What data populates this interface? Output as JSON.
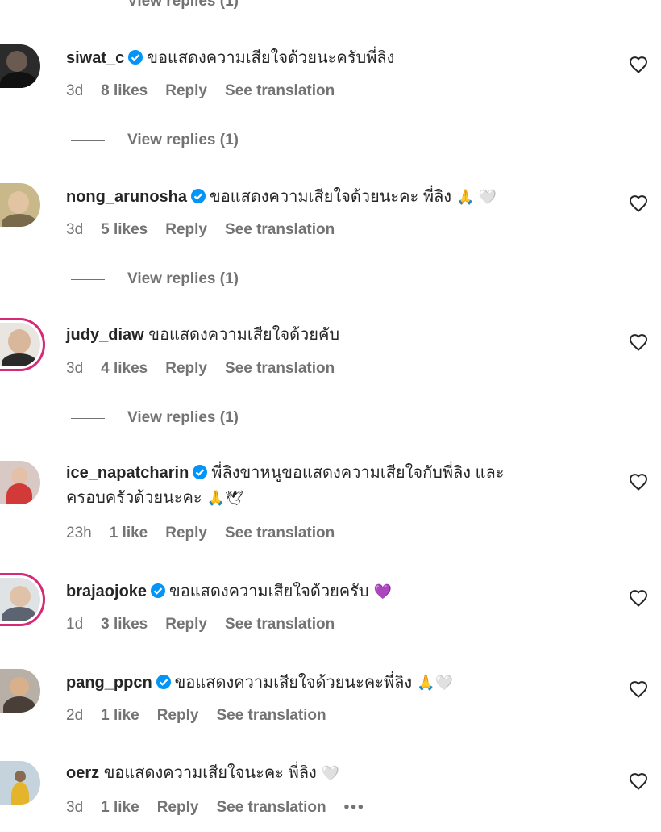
{
  "view_replies_label": "View replies (1)",
  "reply_label": "Reply",
  "see_translation_label": "See translation",
  "more_dots": "•••",
  "colors": {
    "verified": "#0095f6",
    "ring": "#d62976",
    "muted": "#737373",
    "text": "#262626"
  },
  "comments": [
    {
      "user": "siwat_c",
      "verified": true,
      "text": "ขอแสดงความเสียใจด้วยนะครับพี่ลิง",
      "text2": "",
      "emoji": "",
      "time": "3d",
      "likes": "8 likes",
      "avatar_ring": false
    },
    {
      "user": "nong_arunosha",
      "verified": true,
      "text": "ขอแสดงความเสียใจด้วยนะคะ พี่ลิง",
      "text2": "",
      "emoji": "🙏 🤍",
      "time": "3d",
      "likes": "5 likes",
      "avatar_ring": false
    },
    {
      "user": "judy_diaw",
      "verified": false,
      "text": "ขอแสดงความเสียใจด้วยคับ",
      "text2": "",
      "emoji": "",
      "time": "3d",
      "likes": "4 likes",
      "avatar_ring": true
    },
    {
      "user": "ice_napatcharin",
      "verified": true,
      "text": "พี่ลิงขาหนูขอแสดงความเสียใจกับพี่ลิง และ",
      "text2": "ครอบครัวด้วยนะคะ",
      "emoji": "🙏🕊",
      "time": "23h",
      "likes": "1 like",
      "avatar_ring": false
    },
    {
      "user": "brajaojoke",
      "verified": true,
      "text": "ขอแสดงความเสียใจด้วยครับ",
      "text2": "",
      "emoji": "💜",
      "time": "1d",
      "likes": "3 likes",
      "avatar_ring": true
    },
    {
      "user": "pang_ppcn",
      "verified": true,
      "text": "ขอแสดงความเสียใจด้วยนะคะพี่ลิง",
      "text2": "",
      "emoji": "🙏🤍",
      "time": "2d",
      "likes": "1 like",
      "avatar_ring": false
    },
    {
      "user": "oerz",
      "verified": false,
      "text": "ขอแสดงความเสียใจนะคะ พี่ลิง",
      "text2": "",
      "emoji": "🤍",
      "time": "3d",
      "likes": "1 like",
      "avatar_ring": false
    }
  ]
}
